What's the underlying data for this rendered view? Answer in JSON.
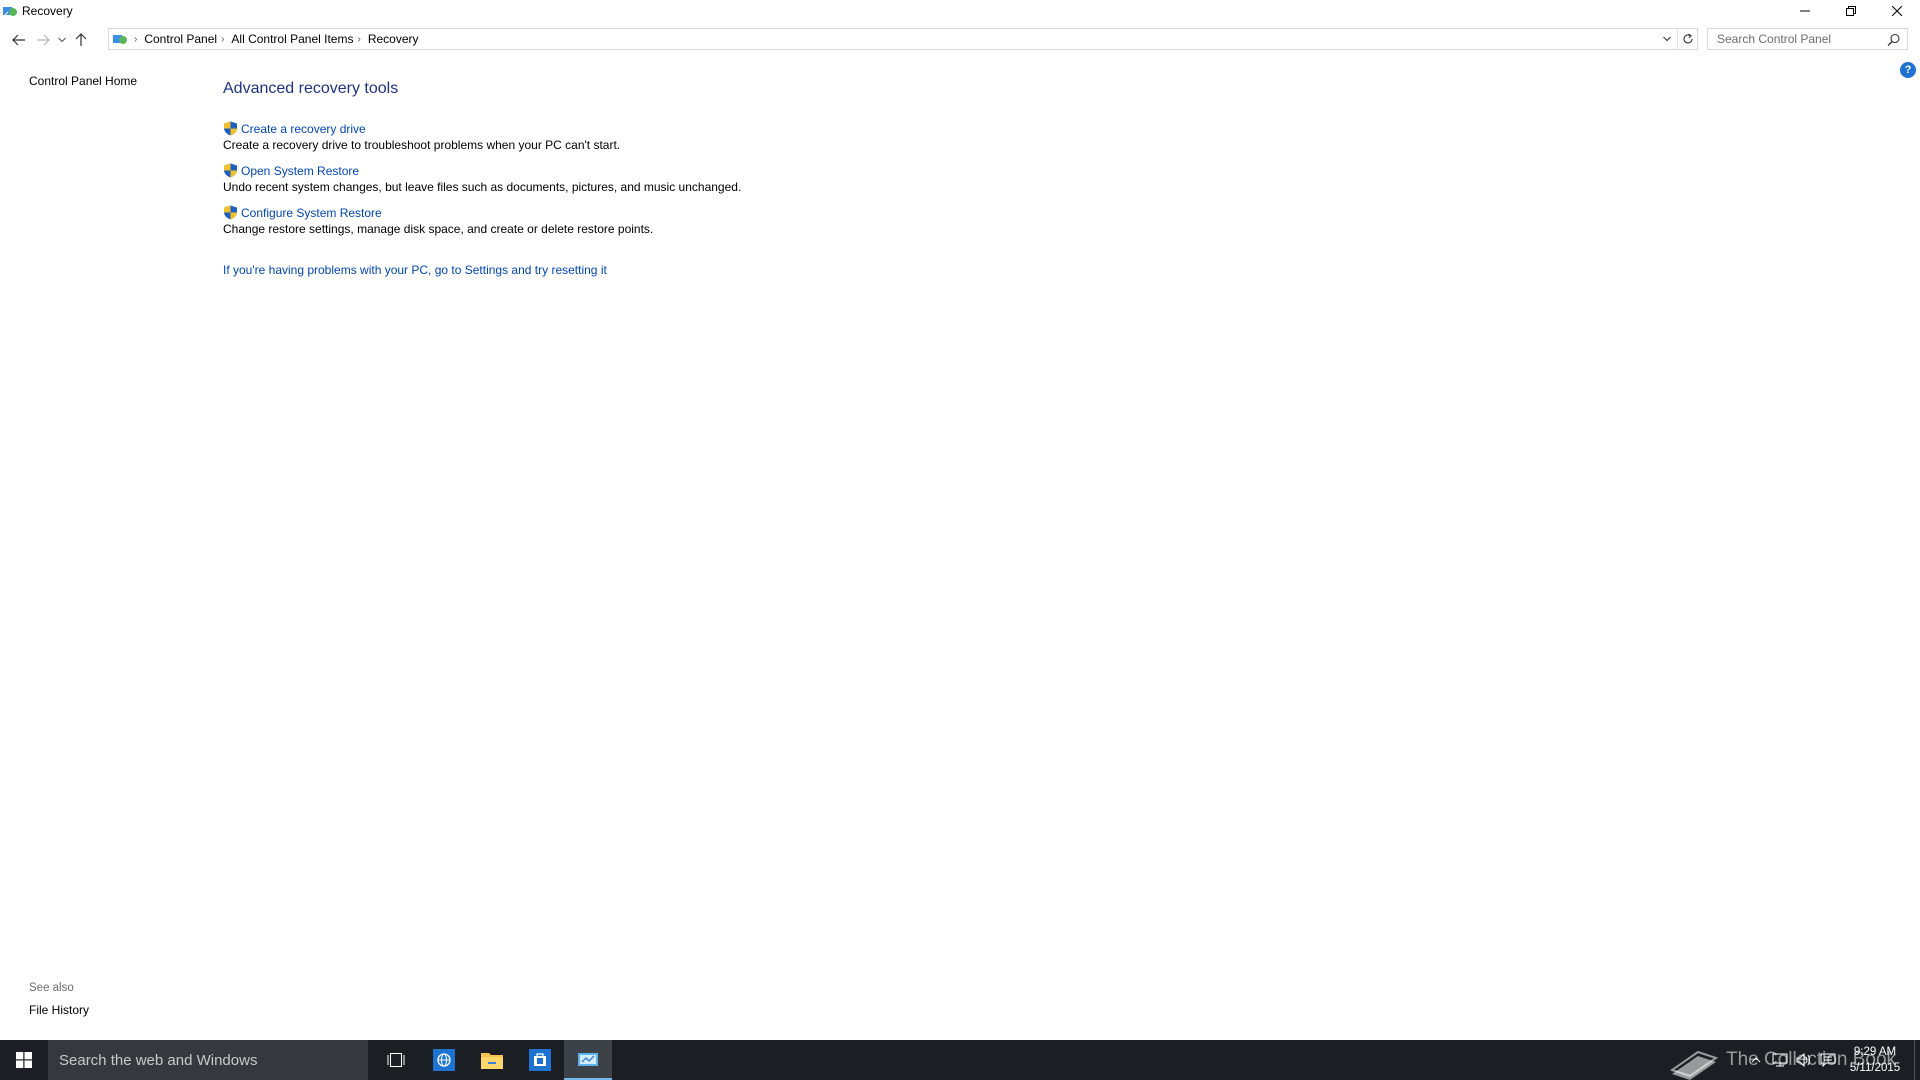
{
  "window": {
    "title": "Recovery",
    "icons": {
      "app": "control-panel-icon",
      "minimize": "minimize-icon",
      "restore": "restore-icon",
      "close": "close-icon"
    }
  },
  "navigation": {
    "breadcrumb": [
      "Control Panel",
      "All Control Panel Items",
      "Recovery"
    ],
    "search_placeholder": "Search Control Panel"
  },
  "left_pane": {
    "home_link": "Control Panel Home",
    "see_also_title": "See also",
    "see_also_items": [
      "File History"
    ]
  },
  "main": {
    "title": "Advanced recovery tools",
    "tools": [
      {
        "label": "Create a recovery drive",
        "description": "Create a recovery drive to troubleshoot problems when your PC can't start."
      },
      {
        "label": "Open System Restore",
        "description": "Undo recent system changes, but leave files such as documents, pictures, and music unchanged."
      },
      {
        "label": "Configure System Restore",
        "description": "Change restore settings, manage disk space, and create or delete restore points."
      }
    ],
    "reset_link": "If you're having problems with your PC, go to Settings and try resetting it",
    "help_label": "?"
  },
  "taskbar": {
    "search_placeholder": "Search the web and Windows",
    "watermark": "The Collection Book",
    "clock_time": "9:29 AM",
    "clock_date": "5/11/2015"
  },
  "colors": {
    "link": "#0046b5",
    "title": "#1e3287",
    "taskbar": "#1b1f24",
    "accent": "#76b9ed"
  }
}
